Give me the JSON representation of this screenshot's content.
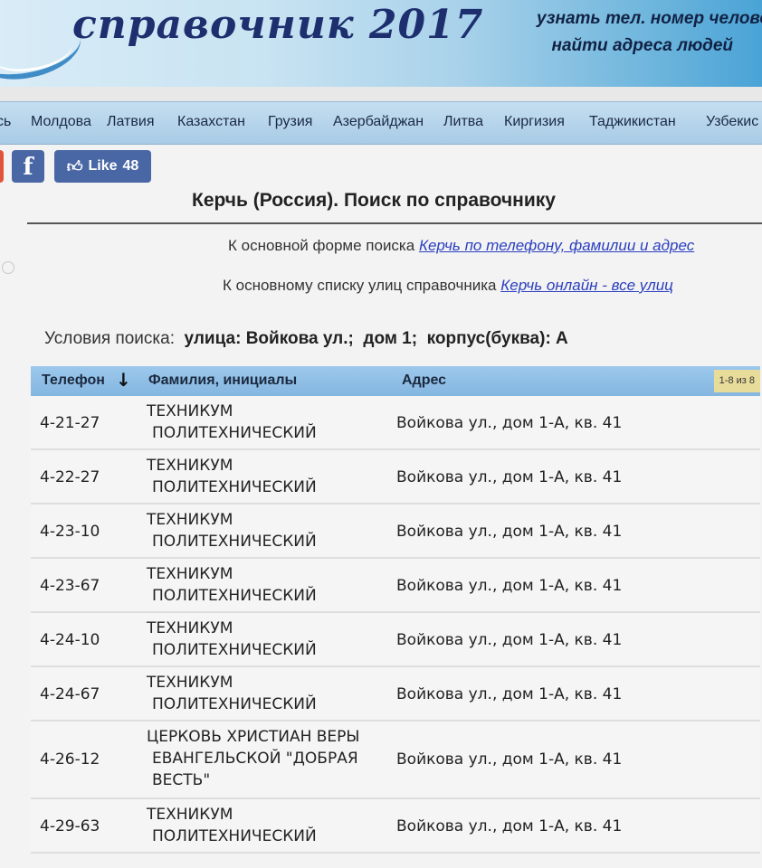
{
  "header": {
    "site_title": "справочник 2017",
    "tagline_1": "узнать тел. номер челове",
    "tagline_2": "найти адреса людей"
  },
  "nav": {
    "items": [
      "сь",
      "Молдова",
      "Латвия",
      "Казахстан",
      "Грузия",
      "Азербайджан",
      "Литва",
      "Киргизия",
      "Таджикистан",
      "Узбекис"
    ]
  },
  "social": {
    "fb_label": "f",
    "like_label": "Like",
    "like_count": "48"
  },
  "page_title": "Керчь (Россия). Поиск по справочнику",
  "links": {
    "search_form_text": "К основной форме поиска",
    "search_form_link": "Керчь по телефону, фамилии и адрес",
    "streets_text": "К основному списку улиц справочника",
    "streets_link": "Керчь онлайн - все улиц"
  },
  "conditions": {
    "label": "Условия поиска:",
    "street": "улица: Войкова ул.;",
    "house": "дом 1;",
    "building": "корпус(буква): А"
  },
  "table": {
    "headers": {
      "phone": "Телефон",
      "name": "Фамилия, инициалы",
      "address": "Адрес"
    },
    "sort_icon": "↓",
    "counter": "1-8 из 8",
    "rows": [
      {
        "phone": "4-21-27",
        "name": [
          "ТЕХНИКУМ",
          "ПОЛИТЕХНИЧЕСКИЙ"
        ],
        "address": "Войкова ул., дом 1-А, кв. 41"
      },
      {
        "phone": "4-22-27",
        "name": [
          "ТЕХНИКУМ",
          "ПОЛИТЕХНИЧЕСКИЙ"
        ],
        "address": "Войкова ул., дом 1-А, кв. 41"
      },
      {
        "phone": "4-23-10",
        "name": [
          "ТЕХНИКУМ",
          "ПОЛИТЕХНИЧЕСКИЙ"
        ],
        "address": "Войкова ул., дом 1-А, кв. 41"
      },
      {
        "phone": "4-23-67",
        "name": [
          "ТЕХНИКУМ",
          "ПОЛИТЕХНИЧЕСКИЙ"
        ],
        "address": "Войкова ул., дом 1-А, кв. 41"
      },
      {
        "phone": "4-24-10",
        "name": [
          "ТЕХНИКУМ",
          "ПОЛИТЕХНИЧЕСКИЙ"
        ],
        "address": "Войкова ул., дом 1-А, кв. 41"
      },
      {
        "phone": "4-24-67",
        "name": [
          "ТЕХНИКУМ",
          "ПОЛИТЕХНИЧЕСКИЙ"
        ],
        "address": "Войкова ул., дом 1-А, кв. 41"
      },
      {
        "phone": "4-26-12",
        "name": [
          "ЦЕРКОВЬ ХРИСТИАН ВЕРЫ",
          "ЕВАНГЕЛЬСКОЙ \"ДОБРАЯ",
          "ВЕСТЬ\""
        ],
        "address": "Войкова ул., дом 1-А, кв. 41"
      },
      {
        "phone": "4-29-63",
        "name": [
          "ТЕХНИКУМ",
          "ПОЛИТЕХНИЧЕСКИЙ"
        ],
        "address": "Войкова ул., дом 1-А, кв. 41"
      }
    ]
  }
}
